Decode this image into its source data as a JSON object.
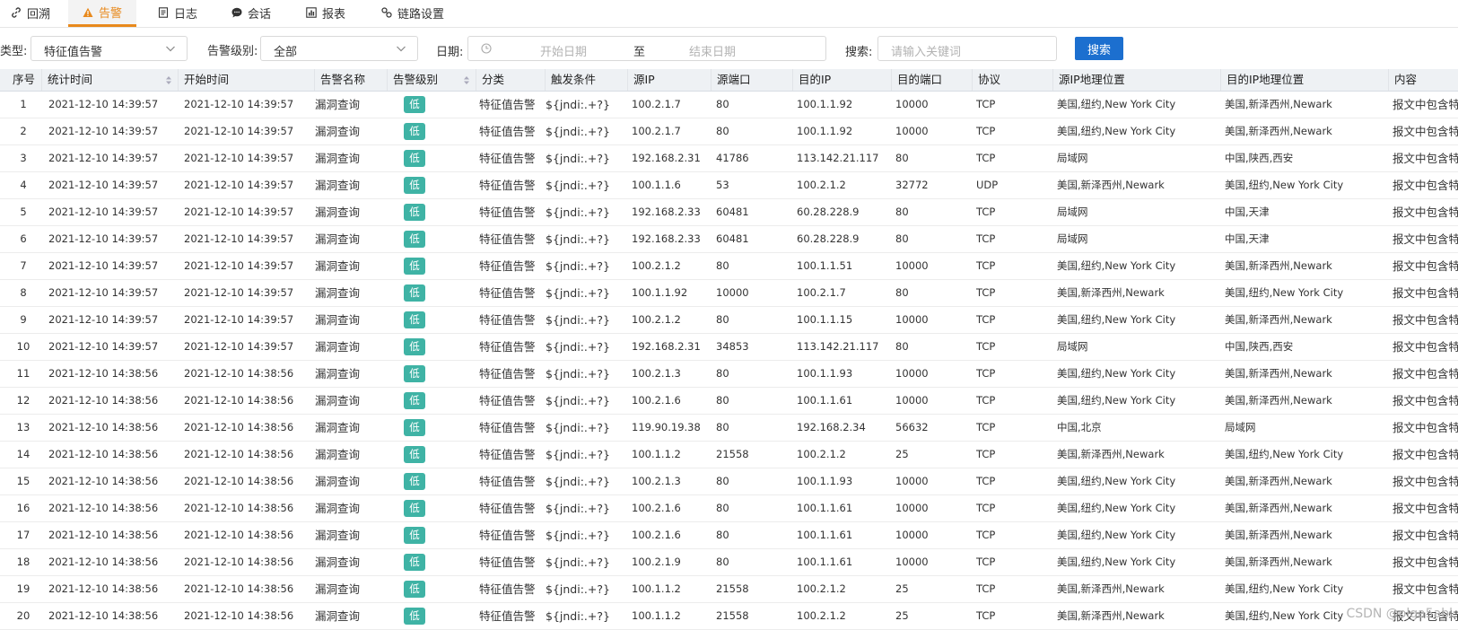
{
  "tabs": [
    {
      "label": "回溯",
      "icon": "link-icon"
    },
    {
      "label": "告警",
      "icon": "warning-icon",
      "active": true
    },
    {
      "label": "日志",
      "icon": "document-icon"
    },
    {
      "label": "会话",
      "icon": "chat-icon"
    },
    {
      "label": "报表",
      "icon": "report-icon"
    },
    {
      "label": "链路设置",
      "icon": "settings-link-icon"
    }
  ],
  "filters": {
    "type_label": "类型:",
    "type_value": "特征值告警",
    "level_label": "告警级别:",
    "level_value": "全部",
    "date_label": "日期:",
    "date_start_placeholder": "开始日期",
    "date_sep": "至",
    "date_end_placeholder": "结束日期",
    "search_label": "搜索:",
    "search_placeholder": "请输入关键词",
    "search_button": "搜索"
  },
  "columns": [
    "序号",
    "统计时间",
    "开始时间",
    "告警名称",
    "告警级别",
    "分类",
    "触发条件",
    "源IP",
    "源端口",
    "目的IP",
    "目的端口",
    "协议",
    "源IP地理位置",
    "目的IP地理位置",
    "内容"
  ],
  "rows": [
    [
      "1",
      "2021-12-10 14:39:57",
      "2021-12-10 14:39:57",
      "漏洞查询",
      "低",
      "特征值告警",
      "${jndi:.+?}",
      "100.2.1.7",
      "80",
      "100.1.1.92",
      "10000",
      "TCP",
      "美国,纽约,New York City",
      "美国,新泽西州,Newark",
      "报文中包含特"
    ],
    [
      "2",
      "2021-12-10 14:39:57",
      "2021-12-10 14:39:57",
      "漏洞查询",
      "低",
      "特征值告警",
      "${jndi:.+?}",
      "100.2.1.7",
      "80",
      "100.1.1.92",
      "10000",
      "TCP",
      "美国,纽约,New York City",
      "美国,新泽西州,Newark",
      "报文中包含特"
    ],
    [
      "3",
      "2021-12-10 14:39:57",
      "2021-12-10 14:39:57",
      "漏洞查询",
      "低",
      "特征值告警",
      "${jndi:.+?}",
      "192.168.2.31",
      "41786",
      "113.142.21.117",
      "80",
      "TCP",
      "局域网",
      "中国,陕西,西安",
      "报文中包含特"
    ],
    [
      "4",
      "2021-12-10 14:39:57",
      "2021-12-10 14:39:57",
      "漏洞查询",
      "低",
      "特征值告警",
      "${jndi:.+?}",
      "100.1.1.6",
      "53",
      "100.2.1.2",
      "32772",
      "UDP",
      "美国,新泽西州,Newark",
      "美国,纽约,New York City",
      "报文中包含特"
    ],
    [
      "5",
      "2021-12-10 14:39:57",
      "2021-12-10 14:39:57",
      "漏洞查询",
      "低",
      "特征值告警",
      "${jndi:.+?}",
      "192.168.2.33",
      "60481",
      "60.28.228.9",
      "80",
      "TCP",
      "局域网",
      "中国,天津",
      "报文中包含特"
    ],
    [
      "6",
      "2021-12-10 14:39:57",
      "2021-12-10 14:39:57",
      "漏洞查询",
      "低",
      "特征值告警",
      "${jndi:.+?}",
      "192.168.2.33",
      "60481",
      "60.28.228.9",
      "80",
      "TCP",
      "局域网",
      "中国,天津",
      "报文中包含特"
    ],
    [
      "7",
      "2021-12-10 14:39:57",
      "2021-12-10 14:39:57",
      "漏洞查询",
      "低",
      "特征值告警",
      "${jndi:.+?}",
      "100.2.1.2",
      "80",
      "100.1.1.51",
      "10000",
      "TCP",
      "美国,纽约,New York City",
      "美国,新泽西州,Newark",
      "报文中包含特"
    ],
    [
      "8",
      "2021-12-10 14:39:57",
      "2021-12-10 14:39:57",
      "漏洞查询",
      "低",
      "特征值告警",
      "${jndi:.+?}",
      "100.1.1.92",
      "10000",
      "100.2.1.7",
      "80",
      "TCP",
      "美国,新泽西州,Newark",
      "美国,纽约,New York City",
      "报文中包含特"
    ],
    [
      "9",
      "2021-12-10 14:39:57",
      "2021-12-10 14:39:57",
      "漏洞查询",
      "低",
      "特征值告警",
      "${jndi:.+?}",
      "100.2.1.2",
      "80",
      "100.1.1.15",
      "10000",
      "TCP",
      "美国,纽约,New York City",
      "美国,新泽西州,Newark",
      "报文中包含特"
    ],
    [
      "10",
      "2021-12-10 14:39:57",
      "2021-12-10 14:39:57",
      "漏洞查询",
      "低",
      "特征值告警",
      "${jndi:.+?}",
      "192.168.2.31",
      "34853",
      "113.142.21.117",
      "80",
      "TCP",
      "局域网",
      "中国,陕西,西安",
      "报文中包含特"
    ],
    [
      "11",
      "2021-12-10 14:38:56",
      "2021-12-10 14:38:56",
      "漏洞查询",
      "低",
      "特征值告警",
      "${jndi:.+?}",
      "100.2.1.3",
      "80",
      "100.1.1.93",
      "10000",
      "TCP",
      "美国,纽约,New York City",
      "美国,新泽西州,Newark",
      "报文中包含特"
    ],
    [
      "12",
      "2021-12-10 14:38:56",
      "2021-12-10 14:38:56",
      "漏洞查询",
      "低",
      "特征值告警",
      "${jndi:.+?}",
      "100.2.1.6",
      "80",
      "100.1.1.61",
      "10000",
      "TCP",
      "美国,纽约,New York City",
      "美国,新泽西州,Newark",
      "报文中包含特"
    ],
    [
      "13",
      "2021-12-10 14:38:56",
      "2021-12-10 14:38:56",
      "漏洞查询",
      "低",
      "特征值告警",
      "${jndi:.+?}",
      "119.90.19.38",
      "80",
      "192.168.2.34",
      "56632",
      "TCP",
      "中国,北京",
      "局域网",
      "报文中包含特"
    ],
    [
      "14",
      "2021-12-10 14:38:56",
      "2021-12-10 14:38:56",
      "漏洞查询",
      "低",
      "特征值告警",
      "${jndi:.+?}",
      "100.1.1.2",
      "21558",
      "100.2.1.2",
      "25",
      "TCP",
      "美国,新泽西州,Newark",
      "美国,纽约,New York City",
      "报文中包含特"
    ],
    [
      "15",
      "2021-12-10 14:38:56",
      "2021-12-10 14:38:56",
      "漏洞查询",
      "低",
      "特征值告警",
      "${jndi:.+?}",
      "100.2.1.3",
      "80",
      "100.1.1.93",
      "10000",
      "TCP",
      "美国,纽约,New York City",
      "美国,新泽西州,Newark",
      "报文中包含特"
    ],
    [
      "16",
      "2021-12-10 14:38:56",
      "2021-12-10 14:38:56",
      "漏洞查询",
      "低",
      "特征值告警",
      "${jndi:.+?}",
      "100.2.1.6",
      "80",
      "100.1.1.61",
      "10000",
      "TCP",
      "美国,纽约,New York City",
      "美国,新泽西州,Newark",
      "报文中包含特"
    ],
    [
      "17",
      "2021-12-10 14:38:56",
      "2021-12-10 14:38:56",
      "漏洞查询",
      "低",
      "特征值告警",
      "${jndi:.+?}",
      "100.2.1.6",
      "80",
      "100.1.1.61",
      "10000",
      "TCP",
      "美国,纽约,New York City",
      "美国,新泽西州,Newark",
      "报文中包含特"
    ],
    [
      "18",
      "2021-12-10 14:38:56",
      "2021-12-10 14:38:56",
      "漏洞查询",
      "低",
      "特征值告警",
      "${jndi:.+?}",
      "100.2.1.9",
      "80",
      "100.1.1.61",
      "10000",
      "TCP",
      "美国,纽约,New York City",
      "美国,新泽西州,Newark",
      "报文中包含特"
    ],
    [
      "19",
      "2021-12-10 14:38:56",
      "2021-12-10 14:38:56",
      "漏洞查询",
      "低",
      "特征值告警",
      "${jndi:.+?}",
      "100.1.1.2",
      "21558",
      "100.2.1.2",
      "25",
      "TCP",
      "美国,新泽西州,Newark",
      "美国,纽约,New York City",
      "报文中包含特"
    ],
    [
      "20",
      "2021-12-10 14:38:56",
      "2021-12-10 14:38:56",
      "漏洞查询",
      "低",
      "特征值告警",
      "${jndi:.+?}",
      "100.1.1.2",
      "21558",
      "100.2.1.2",
      "25",
      "TCP",
      "美国,新泽西州,Newark",
      "美国,纽约,New York City",
      "报文中包含特"
    ]
  ],
  "watermark": "CSDN @olga5abl",
  "colors": {
    "accent": "#e8891c",
    "primary": "#1c6fcf",
    "badge_low": "#3fb3a5",
    "header_bg": "#eef1f4"
  }
}
